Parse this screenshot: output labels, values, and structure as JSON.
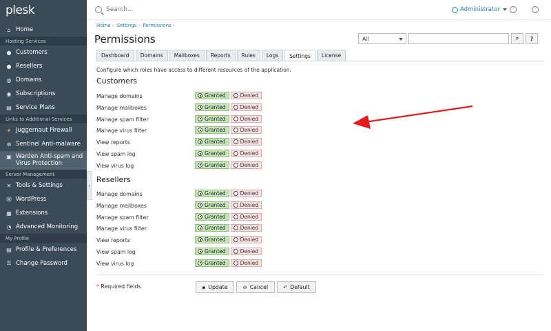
{
  "sidebar": {
    "logo": "plesk",
    "home": "Home",
    "sections": {
      "hosting": "Hosting Services",
      "links": "Links to Additional Services",
      "server": "Server Management",
      "profile": "My Profile"
    },
    "hosting_items": [
      "Customers",
      "Resellers",
      "Domains",
      "Subscriptions",
      "Service Plans"
    ],
    "link_items": [
      "Juggernaut Firewall",
      "Sentinel Anti-malware",
      "Warden Anti-spam and Virus Protection"
    ],
    "server_items": [
      "Tools & Settings",
      "WordPress",
      "Extensions",
      "Advanced Monitoring"
    ],
    "profile_items": [
      "Profile & Preferences",
      "Change Password"
    ]
  },
  "header": {
    "search_placeholder": "Search...",
    "user": "Administrator"
  },
  "breadcrumb": [
    "Home",
    "Settings",
    "Permissions"
  ],
  "page_title": "Permissions",
  "filter": {
    "selected": "All",
    "search_btn": "⌕",
    "help_btn": "?"
  },
  "tabs": [
    "Dashboard",
    "Domains",
    "Mailboxes",
    "Reports",
    "Rules",
    "Logs",
    "Settings",
    "License"
  ],
  "active_tab": "Settings",
  "description": "Configure which roles have access to different resources of the application.",
  "groups": [
    {
      "title": "Customers",
      "rows": [
        {
          "label": "Manage domains",
          "value": "Granted"
        },
        {
          "label": "Manage mailboxes",
          "value": "Granted"
        },
        {
          "label": "Manage spam filter",
          "value": "Granted"
        },
        {
          "label": "Manage virus filter",
          "value": "Granted"
        },
        {
          "label": "View reports",
          "value": "Granted"
        },
        {
          "label": "View spam log",
          "value": "Granted"
        },
        {
          "label": "View virus log",
          "value": "Granted"
        }
      ]
    },
    {
      "title": "Resellers",
      "rows": [
        {
          "label": "Manage domains",
          "value": "Granted"
        },
        {
          "label": "Manage mailboxes",
          "value": "Granted"
        },
        {
          "label": "Manage spam filter",
          "value": "Granted"
        },
        {
          "label": "Manage virus filter",
          "value": "Granted"
        },
        {
          "label": "View reports",
          "value": "Granted"
        },
        {
          "label": "View spam log",
          "value": "Granted"
        },
        {
          "label": "View virus log",
          "value": "Granted"
        }
      ]
    }
  ],
  "options": {
    "granted": "Granted",
    "denied": "Denied"
  },
  "footer": {
    "required": "Required fields",
    "required_mark": "*",
    "update": "Update",
    "cancel": "Cancel",
    "default": "Default"
  },
  "colors": {
    "sidebar": "#3b4a57",
    "accent": "#2a7bbd",
    "granted": "#c6e6b8",
    "denied": "#fbe4e4",
    "annotation_arrow": "#e11d1d"
  }
}
